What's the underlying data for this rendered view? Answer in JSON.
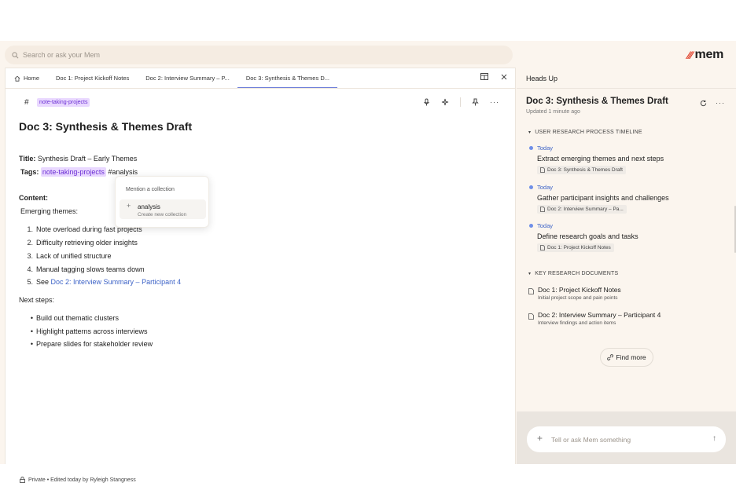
{
  "search": {
    "placeholder": "Search or ask your Mem"
  },
  "brand": {
    "name": "mem",
    "accent": "#e0442e"
  },
  "tabs": [
    {
      "label": "Home",
      "icon": "home-icon"
    },
    {
      "label": "Doc 1: Project Kickoff Notes"
    },
    {
      "label": "Doc 2: Interview Summary – P..."
    },
    {
      "label": "Doc 3: Synthesis & Themes D...",
      "active": true
    }
  ],
  "toolbar": {
    "hash": "#",
    "tag": "note-taking-projects"
  },
  "doc": {
    "title": "Doc 3: Synthesis & Themes Draft",
    "title_label": "Title:",
    "title_value": "Synthesis Draft – Early Themes",
    "tags_label": "Tags:",
    "tag_chip": "note-taking-projects",
    "tag_typed": "#analysis",
    "content_label": "Content:",
    "emerging_label": "Emerging themes:",
    "themes": [
      "Note overload during fast projects",
      "Difficulty retrieving older insights",
      "Lack of unified structure",
      "Manual tagging slows teams down"
    ],
    "theme5_prefix": "See",
    "theme5_link": "Doc 2: Interview Summary – Participant 4",
    "next_label": "Next steps:",
    "next_steps": [
      "Build out thematic clusters",
      "Highlight patterns across interviews",
      "Prepare slides for stakeholder review"
    ]
  },
  "popup": {
    "title": "Mention a collection",
    "option_label": "analysis",
    "option_sub": "Create new collection"
  },
  "footer": {
    "text": "Private • Edited today by Ryleigh Stangness"
  },
  "panel": {
    "header": "Heads Up",
    "title": "Doc 3: Synthesis & Themes Draft",
    "updated": "Updated 1 minute ago",
    "timeline_header": "USER RESEARCH PROCESS TIMELINE",
    "timeline": [
      {
        "date": "Today",
        "text": "Extract emerging themes and next steps",
        "ref": "Doc 3: Synthesis & Themes Draft"
      },
      {
        "date": "Today",
        "text": "Gather participant insights and challenges",
        "ref": "Doc 2: Interview Summary – Pa..."
      },
      {
        "date": "Today",
        "text": "Define research goals and tasks",
        "ref": "Doc 1: Project Kickoff Notes"
      }
    ],
    "docs_header": "KEY RESEARCH DOCUMENTS",
    "docs": [
      {
        "title": "Doc 1: Project Kickoff Notes",
        "sub": "Initial project scope and pain points"
      },
      {
        "title": "Doc 2: Interview Summary – Participant 4",
        "sub": "Interview findings and action items"
      }
    ],
    "find_more": "Find more",
    "chat_placeholder": "Tell or ask Mem something"
  }
}
